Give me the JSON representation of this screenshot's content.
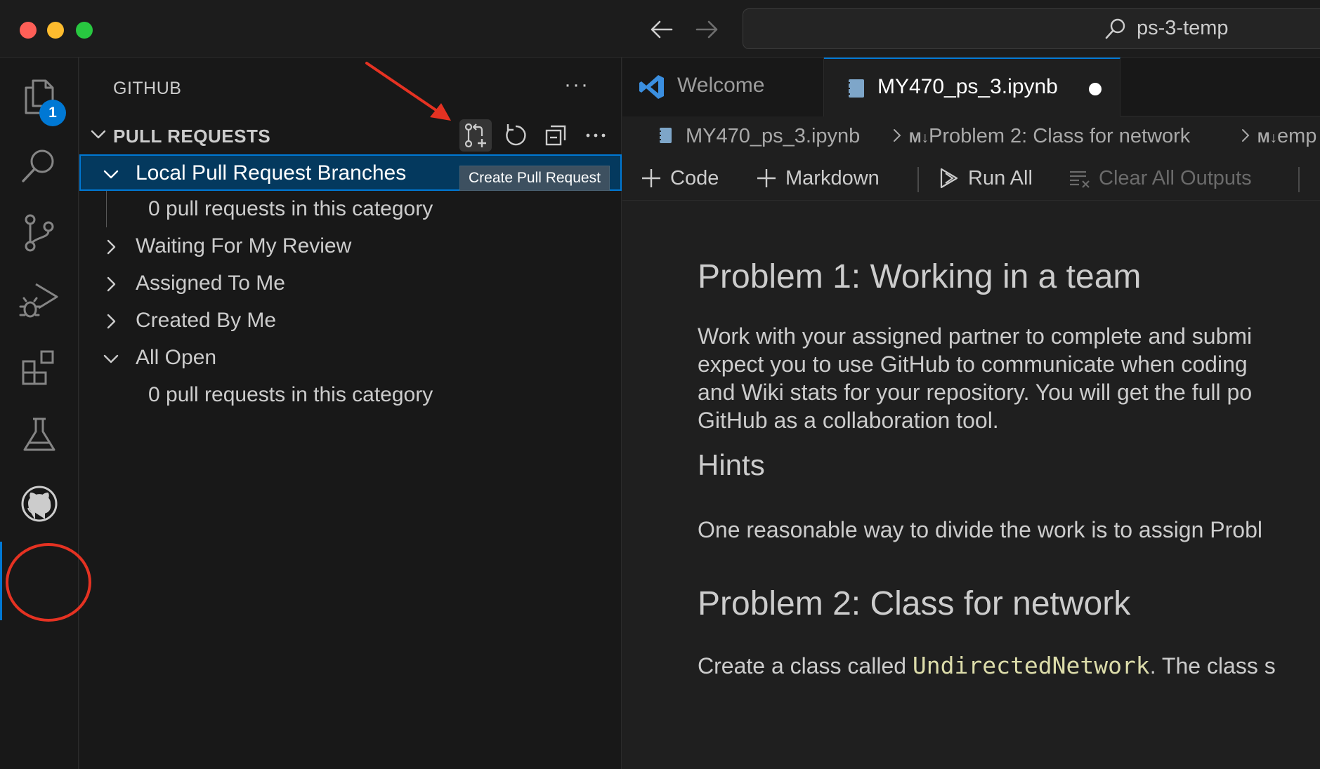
{
  "titlebar": {
    "search_text": "ps-3-temp"
  },
  "activity_bar": {
    "explorer_badge": "1"
  },
  "sidebar": {
    "title": "GITHUB",
    "more": "···",
    "section": {
      "title": "PULL REQUESTS",
      "tooltip": "Create Pull Request"
    },
    "tree": [
      {
        "label": "Local Pull Request Branches",
        "expanded": true
      },
      {
        "label": "0 pull requests in this category"
      },
      {
        "label": "Waiting For My Review",
        "expanded": false
      },
      {
        "label": "Assigned To Me",
        "expanded": false
      },
      {
        "label": "Created By Me",
        "expanded": false
      },
      {
        "label": "All Open",
        "expanded": true
      },
      {
        "label": "0 pull requests in this category"
      }
    ]
  },
  "editor": {
    "tabs": [
      {
        "label": "Welcome"
      },
      {
        "label": "MY470_ps_3.ipynb"
      }
    ],
    "breadcrumb": {
      "file": "MY470_ps_3.ipynb",
      "md_glyph": "M↓",
      "section": "Problem 2: Class for network",
      "next": "emp"
    },
    "toolbar": {
      "code": "Code",
      "markdown": "Markdown",
      "run_all": "Run All",
      "clear_all": "Clear All Outputs"
    },
    "content": {
      "h_problem1": "Problem 1: Working in a team",
      "p1_line1": "Work with your assigned partner to complete and submi",
      "p1_line2": "expect you to use GitHub to communicate when coding",
      "p1_line3": "and Wiki stats for your repository. You will get the full po",
      "p1_line4": "GitHub as a collaboration tool.",
      "h_hints": "Hints",
      "hints_line": "One reasonable way to divide the work is to assign Probl",
      "h_problem2": "Problem 2: Class for network",
      "p2_prefix": "Create a class called ",
      "p2_code": "UndirectedNetwork",
      "p2_suffix": ". The class s"
    }
  },
  "colors": {
    "accent": "#0078d4",
    "annotation": "#e53222",
    "selection_bg": "#04395e",
    "inline_code": "#dcdcaa"
  }
}
